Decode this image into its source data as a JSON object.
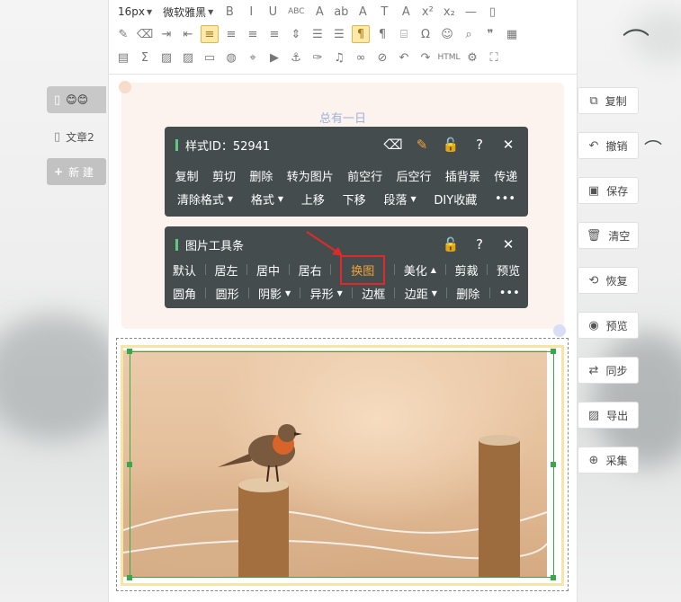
{
  "toolbar": {
    "font_size": "16px",
    "font_family": "微软雅黑",
    "row1_buttons": [
      {
        "icon": "bold-icon",
        "glyph": "B"
      },
      {
        "icon": "italic-icon",
        "glyph": "I"
      },
      {
        "icon": "underline-icon",
        "glyph": "U"
      },
      {
        "icon": "strikethrough-icon",
        "glyph": "ABC"
      },
      {
        "icon": "font-color-icon",
        "glyph": "A"
      },
      {
        "icon": "highlight-icon",
        "glyph": "ab"
      },
      {
        "icon": "font-border-icon",
        "glyph": "A"
      },
      {
        "icon": "text-shadow-icon",
        "glyph": "T"
      },
      {
        "icon": "text-style-icon",
        "glyph": "A"
      },
      {
        "icon": "superscript-icon",
        "glyph": "x²"
      },
      {
        "icon": "subscript-icon",
        "glyph": "x₂"
      },
      {
        "icon": "horizontal-rule-icon",
        "glyph": "—"
      },
      {
        "icon": "page-icon",
        "glyph": "▯"
      }
    ],
    "row2_buttons": [
      {
        "icon": "edit-icon",
        "glyph": "✎"
      },
      {
        "icon": "eraser-icon",
        "glyph": "⌫"
      },
      {
        "icon": "indent-icon",
        "glyph": "⇥"
      },
      {
        "icon": "outdent-icon",
        "glyph": "⇤"
      },
      {
        "icon": "align-left-icon",
        "glyph": "≡",
        "active": true
      },
      {
        "icon": "align-center-icon",
        "glyph": "≡"
      },
      {
        "icon": "align-right-icon",
        "glyph": "≡"
      },
      {
        "icon": "justify-icon",
        "glyph": "≡"
      },
      {
        "icon": "line-height-icon",
        "glyph": "⇕"
      },
      {
        "icon": "paragraph-spacing-icon",
        "glyph": "☰"
      },
      {
        "icon": "list-icon",
        "glyph": "☰"
      },
      {
        "icon": "ltr-icon",
        "glyph": "¶",
        "active": true
      },
      {
        "icon": "rtl-icon",
        "glyph": "¶"
      },
      {
        "icon": "split-icon",
        "glyph": "⌸"
      },
      {
        "icon": "omega-icon",
        "glyph": "Ω"
      },
      {
        "icon": "emoji-icon",
        "glyph": "☺"
      },
      {
        "icon": "find-icon",
        "glyph": "⌕"
      },
      {
        "icon": "quote-icon",
        "glyph": "❞"
      },
      {
        "icon": "table-icon",
        "glyph": "▦"
      }
    ],
    "row3_buttons": [
      {
        "icon": "template-icon",
        "glyph": "▤"
      },
      {
        "icon": "sigma-icon",
        "glyph": "Σ"
      },
      {
        "icon": "image-icon",
        "glyph": "▨"
      },
      {
        "icon": "image-gallery-icon",
        "glyph": "▨"
      },
      {
        "icon": "frame-icon",
        "glyph": "▭"
      },
      {
        "icon": "palette-icon",
        "glyph": "◍"
      },
      {
        "icon": "map-icon",
        "glyph": "⌖"
      },
      {
        "icon": "video-icon",
        "glyph": "▶"
      },
      {
        "icon": "anchor-icon",
        "glyph": "⚓"
      },
      {
        "icon": "brush-icon",
        "glyph": "✑"
      },
      {
        "icon": "music-icon",
        "glyph": "♫"
      },
      {
        "icon": "link-icon",
        "glyph": "∞"
      },
      {
        "icon": "unlink-icon",
        "glyph": "⊘"
      },
      {
        "icon": "undo-icon",
        "glyph": "↶"
      },
      {
        "icon": "redo-icon",
        "glyph": "↷"
      },
      {
        "icon": "html-icon",
        "glyph": "HTML"
      },
      {
        "icon": "settings-icon",
        "glyph": "⚙"
      },
      {
        "icon": "fullscreen-icon",
        "glyph": "⛶"
      }
    ]
  },
  "article": {
    "title_line": "总有一日"
  },
  "style_panel": {
    "title": "样式ID：52941",
    "row1": [
      "复制",
      "剪切",
      "删除",
      "转为图片",
      "前空行",
      "后空行",
      "插背景",
      "传递"
    ],
    "row2": [
      {
        "label": "清除格式",
        "dropdown": true
      },
      {
        "label": "格式",
        "dropdown": true
      },
      {
        "label": "上移",
        "dropdown": false
      },
      {
        "label": "下移",
        "dropdown": false
      },
      {
        "label": "段落",
        "dropdown": true
      },
      {
        "label": "DIY收藏",
        "dropdown": false
      },
      {
        "label": "•••",
        "dropdown": false
      }
    ]
  },
  "image_panel": {
    "title": "图片工具条",
    "row1": [
      {
        "label": "默认"
      },
      {
        "label": "居左"
      },
      {
        "label": "居中"
      },
      {
        "label": "居右"
      },
      {
        "label": "换图",
        "selected": true
      },
      {
        "label": "美化",
        "caret": "▲"
      },
      {
        "label": "剪裁"
      },
      {
        "label": "预览"
      }
    ],
    "row2": [
      {
        "label": "圆角"
      },
      {
        "label": "圆形"
      },
      {
        "label": "阴影",
        "caret": "▼"
      },
      {
        "label": "异形",
        "caret": "▼"
      },
      {
        "label": "边框"
      },
      {
        "label": "边距",
        "caret": "▼"
      },
      {
        "label": "删除"
      },
      {
        "label": "•••"
      }
    ]
  },
  "right_actions": [
    {
      "label": "复制",
      "icon": "copy-icon",
      "glyph": "⧉"
    },
    {
      "label": "撤销",
      "icon": "undo-icon",
      "glyph": "↶"
    },
    {
      "label": "保存",
      "icon": "save-icon",
      "glyph": "▣"
    },
    {
      "label": "清空",
      "icon": "trash-icon",
      "glyph": "🗑"
    },
    {
      "label": "恢复",
      "icon": "restore-icon",
      "glyph": "⟲"
    },
    {
      "label": "预览",
      "icon": "eye-icon",
      "glyph": "◉"
    },
    {
      "label": "同步",
      "icon": "sync-icon",
      "glyph": "⇄"
    },
    {
      "label": "导出",
      "icon": "export-icon",
      "glyph": "▨"
    },
    {
      "label": "采集",
      "icon": "collect-icon",
      "glyph": "⊕"
    }
  ],
  "left_panel": {
    "doc1_emoji": "😊😊",
    "doc2_label": "文章2",
    "new_label": "新 建"
  },
  "colors": {
    "panel_bg": "#454c4d",
    "accent_orange": "#f0a33b",
    "selection_green": "#3aa84a",
    "highlight_red": "#e02a2a"
  }
}
